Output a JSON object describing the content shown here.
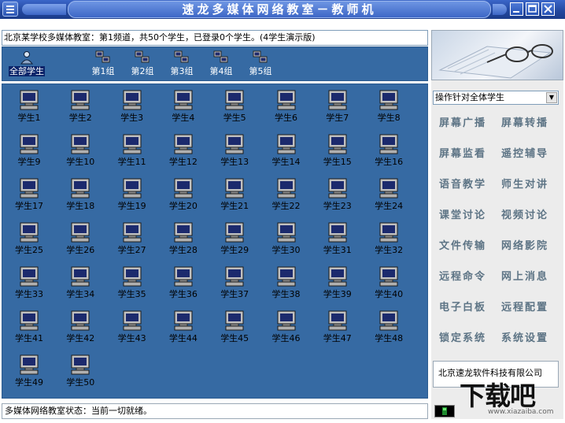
{
  "window": {
    "title": "速龙多媒体网络教室－教师机",
    "controls": [
      "minimize",
      "maximize",
      "close"
    ]
  },
  "info": {
    "text": "北京某学校多媒体教室：第1频道，共50个学生，已登录0个学生。(4学生演示版)"
  },
  "groups": [
    {
      "label": "全部学生",
      "selected": true
    },
    {
      "label": "第1组"
    },
    {
      "label": "第2组"
    },
    {
      "label": "第3组"
    },
    {
      "label": "第4组"
    },
    {
      "label": "第5组"
    }
  ],
  "students": [
    "学生1",
    "学生2",
    "学生3",
    "学生4",
    "学生5",
    "学生6",
    "学生7",
    "学生8",
    "学生9",
    "学生10",
    "学生11",
    "学生12",
    "学生13",
    "学生14",
    "学生15",
    "学生16",
    "学生17",
    "学生18",
    "学生19",
    "学生20",
    "学生21",
    "学生22",
    "学生23",
    "学生24",
    "学生25",
    "学生26",
    "学生27",
    "学生28",
    "学生29",
    "学生30",
    "学生31",
    "学生32",
    "学生33",
    "学生34",
    "学生35",
    "学生36",
    "学生37",
    "学生38",
    "学生39",
    "学生40",
    "学生41",
    "学生42",
    "学生43",
    "学生44",
    "学生45",
    "学生46",
    "学生47",
    "学生48",
    "学生49",
    "学生50"
  ],
  "status": {
    "text": "多媒体网络教室状态：当前一切就绪。"
  },
  "target_select": {
    "value": "操作针对全体学生"
  },
  "functions": [
    "屏幕广播",
    "屏幕转播",
    "屏幕监看",
    "遥控辅导",
    "语音教学",
    "师生对讲",
    "课堂讨论",
    "视频讨论",
    "文件传输",
    "网络影院",
    "远程命令",
    "网上消息",
    "电子白板",
    "远程配置",
    "锁定系统",
    "系统设置"
  ],
  "company": {
    "text": "北京速龙软件科技有限公司"
  },
  "watermark": {
    "big": "下载吧",
    "small": "www.xiazaiba.com"
  },
  "colors": {
    "panel_bg": "#366aa3",
    "titlebar": "#22479d",
    "function_text": "#5d7485"
  }
}
